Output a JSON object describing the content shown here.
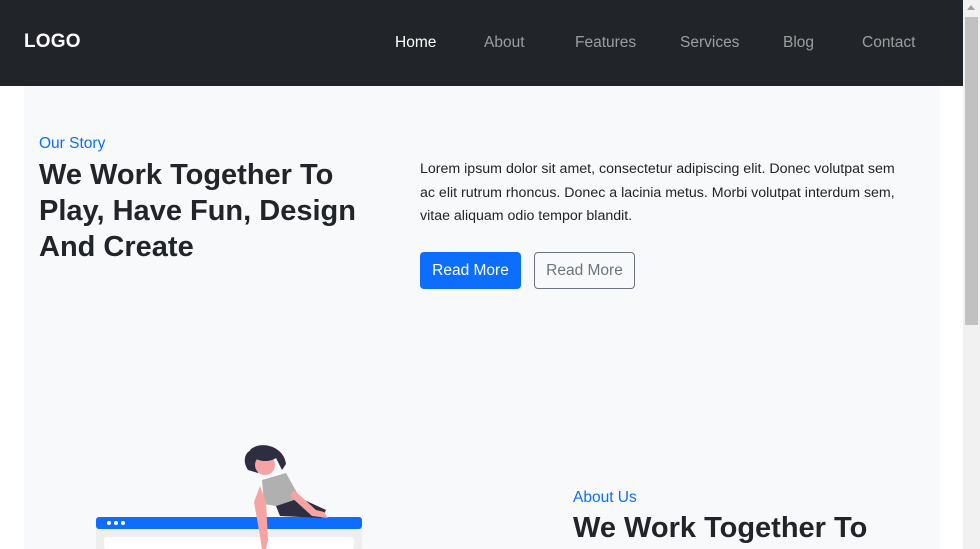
{
  "nav": {
    "logo": "LOGO",
    "links": [
      "Home",
      "About",
      "Features",
      "Services",
      "Blog",
      "Contact"
    ],
    "active_link": "Home"
  },
  "hero": {
    "eyebrow": "Our Story",
    "title_lines": [
      "We Work Together To",
      "Play, Have Fun, Design",
      "And Create"
    ],
    "paragraph_lines": [
      "Lorem ipsum dolor sit amet, consectetur adipiscing elit. Donec volutpat sem",
      "ac elit rutrum rhoncus. Donec a lacinia metus. Morbi volutpat interdum sem,",
      "vitae aliquam odio tempor blandit."
    ],
    "primary_button": "Read More",
    "secondary_button": "Read More"
  },
  "about": {
    "eyebrow": "About Us",
    "title_line_1": "We Work Together To"
  },
  "colors": {
    "navbar_bg": "#212529",
    "section_bg": "#f8f9fa",
    "accent": "#0d6efd",
    "outline_gray": "#6c757d",
    "text_dark": "#212529"
  },
  "icons": {
    "illustration": "person-with-browser-window-illustration"
  }
}
